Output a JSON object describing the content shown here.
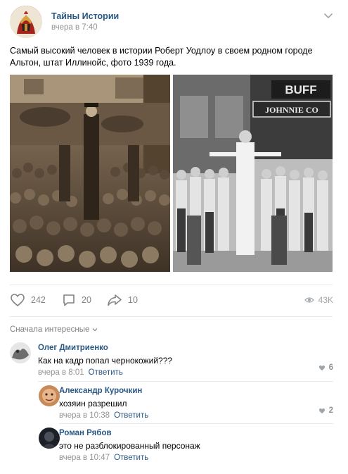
{
  "post": {
    "group_name": "Тайны Истории",
    "time": "вчера в 7:40",
    "text": "Самый высокий человек в истории Роберт Уодлоу в своем родном городе Альтон, штат Иллинойс, фото 1939 года.",
    "photo_sign_text_1": "BUFF",
    "photo_sign_text_2": "JOHNNIE CO"
  },
  "actions": {
    "likes": "242",
    "comments": "20",
    "shares": "10",
    "views": "43K"
  },
  "comments_section": {
    "sort_label": "Сначала интересные"
  },
  "comments": [
    {
      "author": "Олег Дмитриенко",
      "text": "Как на кадр попал чернокожий???",
      "time": "вчера в 8:01",
      "reply": "Ответить",
      "likes": "6"
    },
    {
      "author": "Александр Курочкин",
      "text": "хозяин разрешил",
      "time": "вчера в 10:38",
      "reply": "Ответить",
      "likes": "2"
    },
    {
      "author": "Роман Рябов",
      "text": "это не разблокированный персонаж",
      "time": "вчера в 10:47",
      "reply": "Ответить",
      "likes": ""
    }
  ],
  "colors": {
    "link": "#2a5885",
    "meta": "#939393",
    "icon": "#828282"
  }
}
